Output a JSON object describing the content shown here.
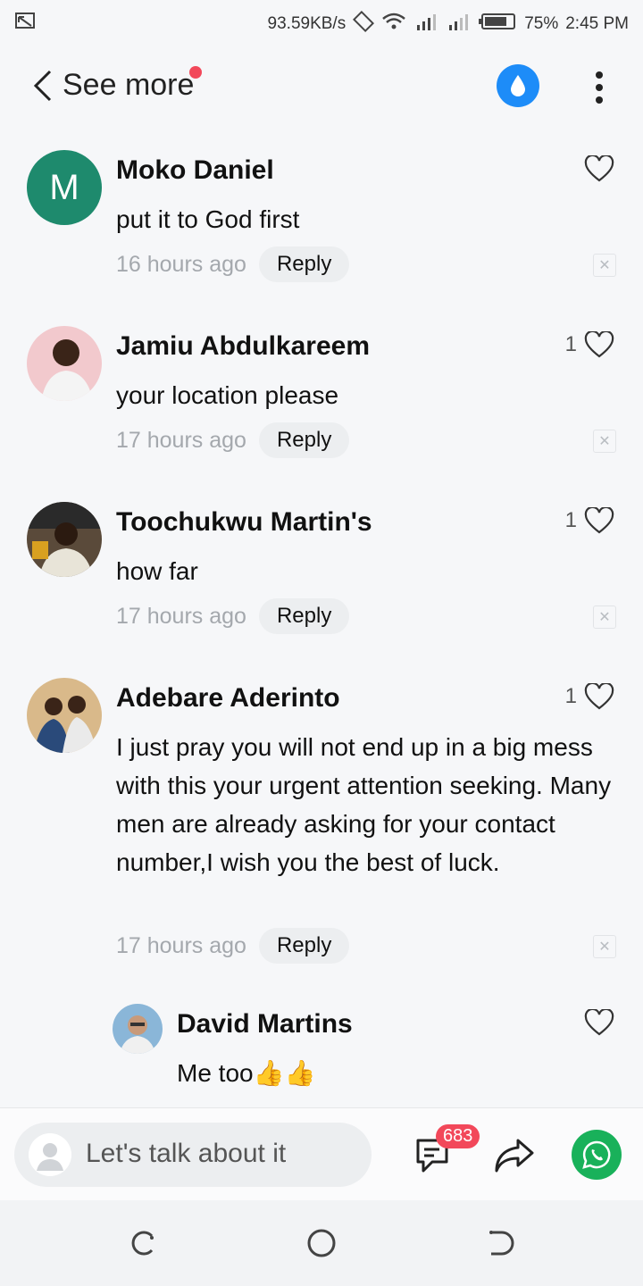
{
  "status": {
    "speed": "93.59KB/s",
    "battery": "75%",
    "time": "2:45 PM"
  },
  "header": {
    "back_label": "See more"
  },
  "comments": [
    {
      "name": "Moko Daniel",
      "text": "put it to God first",
      "time": "16 hours ago",
      "reply": "Reply",
      "likes": "",
      "avatar_letter": "M"
    },
    {
      "name": "Jamiu Abdulkareem",
      "text": "your location please",
      "time": "17 hours ago",
      "reply": "Reply",
      "likes": "1"
    },
    {
      "name": "Toochukwu Martin's",
      "text": "how far",
      "time": "17 hours ago",
      "reply": "Reply",
      "likes": "1"
    },
    {
      "name": "Adebare Aderinto",
      "text": "I just pray you will not end up in a big mess with this your urgent attention seeking. Many men are already asking for your contact number,I wish you the best of luck.",
      "time": "17 hours ago",
      "reply": "Reply",
      "likes": "1"
    }
  ],
  "reply_comment": {
    "name": "David Martins",
    "text": "Me too👍👍",
    "likes": ""
  },
  "input": {
    "placeholder": "Let's talk about it"
  },
  "comment_count": "683",
  "colors": {
    "accent_blue": "#1d8cf8",
    "badge_red": "#f2485a",
    "whatsapp_green": "#19b15a",
    "avatar_green": "#1e8a6d"
  }
}
